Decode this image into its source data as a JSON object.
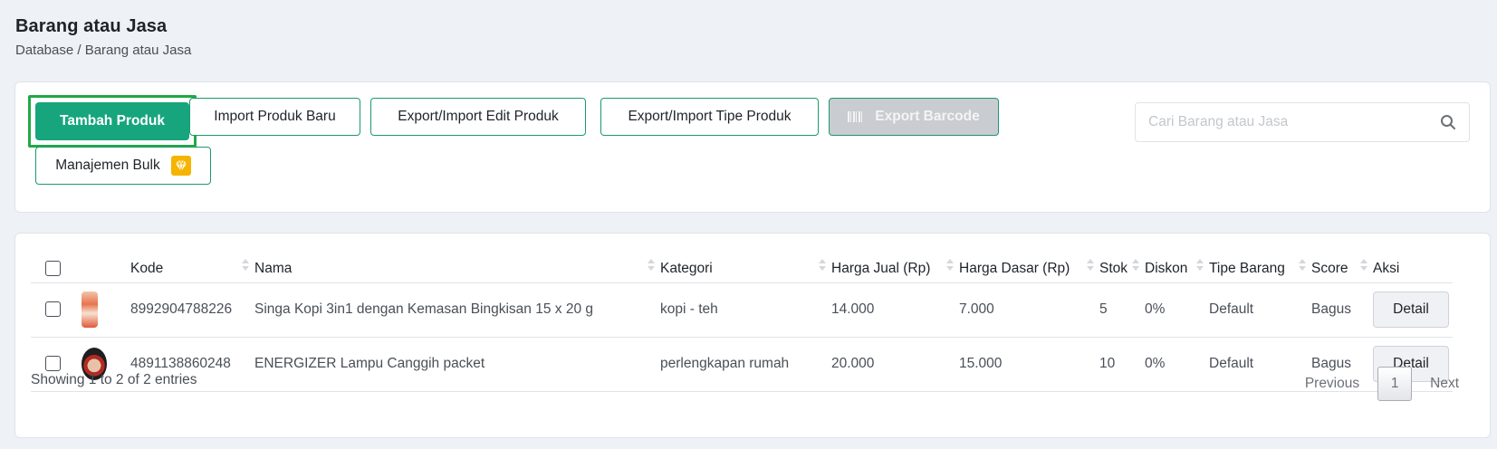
{
  "page": {
    "title": "Barang atau Jasa",
    "breadcrumb": "Database / Barang atau Jasa"
  },
  "toolbar": {
    "add_product": "Tambah Produk",
    "import_new": "Import Produk Baru",
    "export_import_edit": "Export/Import Edit Produk",
    "export_import_type": "Export/Import Tipe Produk",
    "export_barcode": "Export Barcode",
    "bulk_manage": "Manajemen Bulk",
    "search_placeholder": "Cari Barang atau Jasa"
  },
  "table": {
    "columns": [
      "Kode",
      "Nama",
      "Kategori",
      "Harga Jual (Rp)",
      "Harga Dasar (Rp)",
      "Stok",
      "Diskon",
      "Tipe Barang",
      "Score",
      "Aksi"
    ],
    "rows": [
      {
        "kode": "8992904788226",
        "nama": "Singa Kopi 3in1 dengan Kemasan Bingkisan 15 x 20 g",
        "kategori": "kopi - teh",
        "harga_jual": "14.000",
        "harga_dasar": "7.000",
        "stok": "5",
        "diskon": "0%",
        "tipe": "Default",
        "score": "Bagus",
        "aksi": "Detail"
      },
      {
        "kode": "4891138860248",
        "nama": "ENERGIZER Lampu Canggih packet",
        "kategori": "perlengkapan rumah",
        "harga_jual": "20.000",
        "harga_dasar": "15.000",
        "stok": "10",
        "diskon": "0%",
        "tipe": "Default",
        "score": "Bagus",
        "aksi": "Detail"
      }
    ],
    "info": "Showing 1 to 2 of 2 entries",
    "pagination": {
      "previous": "Previous",
      "current": "1",
      "next": "Next"
    }
  },
  "colors": {
    "primary": "#17a57e",
    "highlight_border": "#22a845",
    "button_border": "#1a9a6e",
    "badge": "#f5b400"
  },
  "icons": {
    "barcode": "barcode-icon",
    "gem": "gem-icon",
    "search": "search-icon"
  }
}
